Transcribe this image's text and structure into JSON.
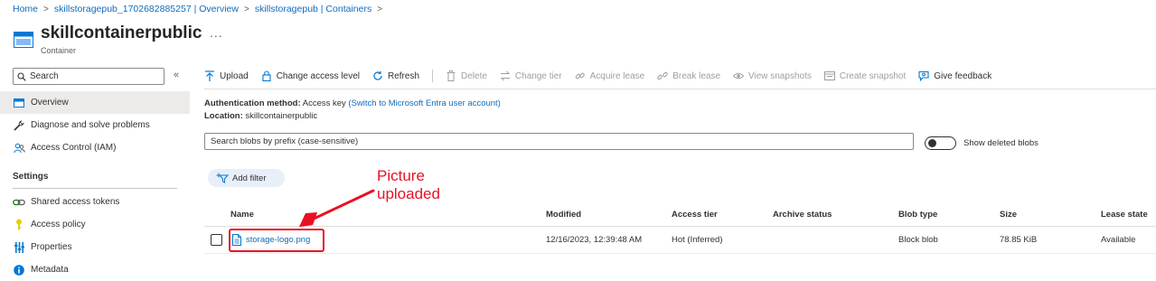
{
  "breadcrumb": {
    "items": [
      "Home",
      "skillstoragepub_1702682885257 | Overview",
      "skillstoragepub | Containers"
    ],
    "separator": ">"
  },
  "header": {
    "title": "skillcontainerpublic",
    "subtitle": "Container",
    "more": "..."
  },
  "sidebar": {
    "search_placeholder": "Search",
    "collapse": "«",
    "items": [
      {
        "label": "Overview",
        "icon": "overview-icon",
        "active": true
      },
      {
        "label": "Diagnose and solve problems",
        "icon": "wrench-icon"
      },
      {
        "label": "Access Control (IAM)",
        "icon": "people-icon"
      }
    ],
    "settings_heading": "Settings",
    "settings_items": [
      {
        "label": "Shared access tokens",
        "icon": "link-icon"
      },
      {
        "label": "Access policy",
        "icon": "key-icon"
      },
      {
        "label": "Properties",
        "icon": "properties-icon"
      },
      {
        "label": "Metadata",
        "icon": "info-icon"
      }
    ]
  },
  "toolbar": {
    "upload": "Upload",
    "change_access_level": "Change access level",
    "refresh": "Refresh",
    "delete": "Delete",
    "change_tier": "Change tier",
    "acquire_lease": "Acquire lease",
    "break_lease": "Break lease",
    "view_snapshots": "View snapshots",
    "create_snapshot": "Create snapshot",
    "give_feedback": "Give feedback"
  },
  "auth": {
    "method_label": "Authentication method:",
    "method_value": "Access key",
    "switch_link": "(Switch to Microsoft Entra user account)",
    "location_label": "Location:",
    "location_value": "skillcontainerpublic"
  },
  "blob_search": {
    "placeholder": "Search blobs by prefix (case-sensitive)"
  },
  "show_deleted": {
    "label": "Show deleted blobs",
    "on": false
  },
  "add_filter": "Add filter",
  "table": {
    "columns": [
      "Name",
      "Modified",
      "Access tier",
      "Archive status",
      "Blob type",
      "Size",
      "Lease state"
    ],
    "rows": [
      {
        "name": "storage-logo.png",
        "modified": "12/16/2023, 12:39:48 AM",
        "access_tier": "Hot (Inferred)",
        "archive_status": "",
        "blob_type": "Block blob",
        "size": "78.85 KiB",
        "lease_state": "Available"
      }
    ]
  },
  "annotation": {
    "line1": "Picture",
    "line2": "uploaded",
    "color": "#e81123"
  },
  "colors": {
    "accent": "#0f6cbd",
    "annotation_red": "#e81123"
  }
}
